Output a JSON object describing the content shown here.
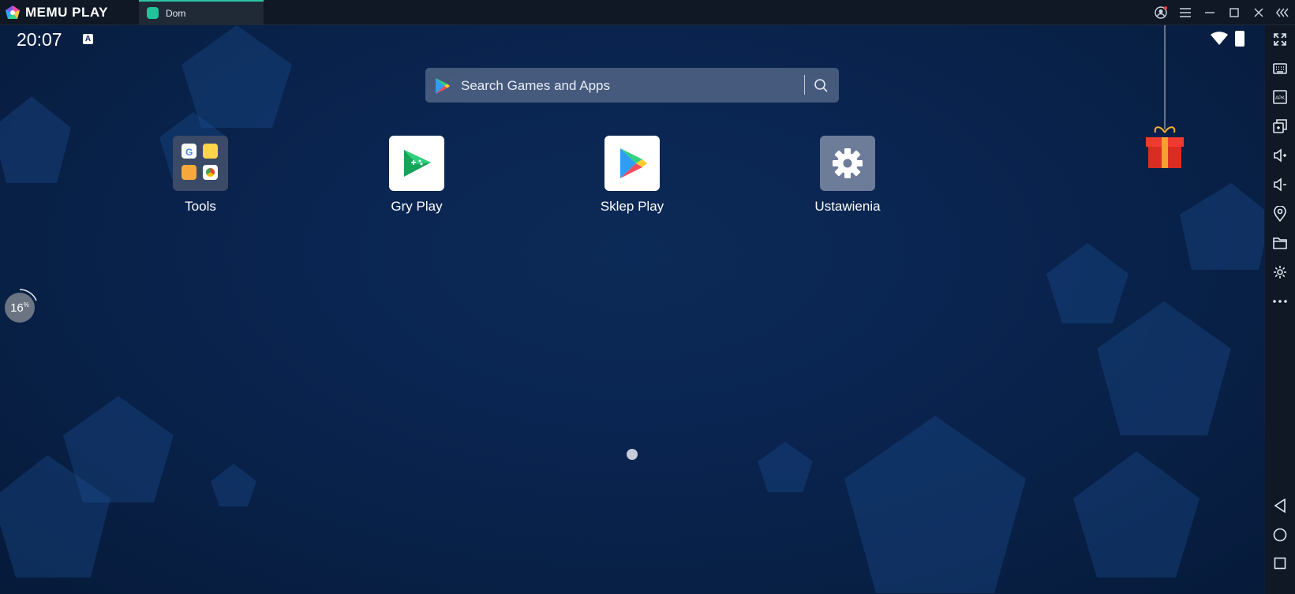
{
  "window": {
    "brand": "MEMU PLAY",
    "tab_label": "Dom",
    "accent": "#2ec4a6"
  },
  "status_bar": {
    "time": "20:07",
    "indicator": "A"
  },
  "search": {
    "placeholder": "Search Games and Apps"
  },
  "apps": [
    {
      "label": "Tools",
      "icon": "tools-folder-icon"
    },
    {
      "label": "Gry Play",
      "icon": "play-games-icon"
    },
    {
      "label": "Sklep Play",
      "icon": "play-store-icon"
    },
    {
      "label": "Ustawienia",
      "icon": "settings-gear-icon"
    }
  ],
  "perf_meter": {
    "value": "16",
    "unit": "%"
  },
  "sidebar": {
    "items": [
      "fullscreen-icon",
      "keyboard-icon",
      "apk-icon",
      "multi-window-icon",
      "volume-up-icon",
      "volume-down-icon",
      "location-icon",
      "folder-icon",
      "settings-icon",
      "more-icon",
      "back-icon",
      "home-icon",
      "recents-icon"
    ]
  }
}
